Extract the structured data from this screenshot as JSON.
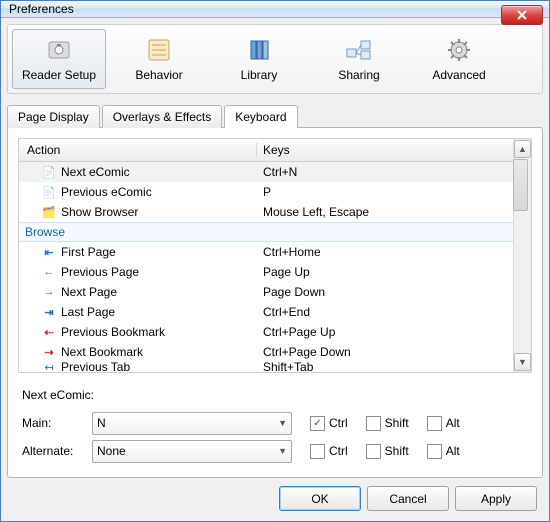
{
  "window": {
    "title": "Preferences"
  },
  "toolbar": {
    "reader_setup": "Reader Setup",
    "behavior": "Behavior",
    "library": "Library",
    "sharing": "Sharing",
    "advanced": "Advanced"
  },
  "tabs": {
    "page_display": "Page Display",
    "overlays": "Overlays & Effects",
    "keyboard": "Keyboard"
  },
  "columns": {
    "action": "Action",
    "keys": "Keys"
  },
  "groups": {
    "browse": "Browse"
  },
  "rows": [
    {
      "label": "Next eComic",
      "keys": "Ctrl+N",
      "selected": true
    },
    {
      "label": "Previous eComic",
      "keys": "P"
    },
    {
      "label": "Show Browser",
      "keys": "Mouse Left, Escape"
    },
    {
      "label": "First Page",
      "keys": "Ctrl+Home"
    },
    {
      "label": "Previous Page",
      "keys": "Page Up"
    },
    {
      "label": "Next Page",
      "keys": "Page Down"
    },
    {
      "label": "Last Page",
      "keys": "Ctrl+End"
    },
    {
      "label": "Previous Bookmark",
      "keys": "Ctrl+Page Up"
    },
    {
      "label": "Next Bookmark",
      "keys": "Ctrl+Page Down"
    },
    {
      "label": "Previous Tab",
      "keys": "Shift+Tab"
    }
  ],
  "form": {
    "title": "Next eComic:",
    "main_label": "Main:",
    "main_value": "N",
    "alt_label": "Alternate:",
    "alt_value": "None",
    "ctrl": "Ctrl",
    "shift": "Shift",
    "alt": "Alt",
    "main_ctrl_checked": true
  },
  "buttons": {
    "ok": "OK",
    "cancel": "Cancel",
    "apply": "Apply"
  }
}
